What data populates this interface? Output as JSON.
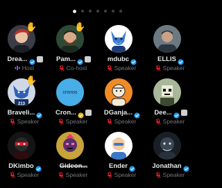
{
  "pager": {
    "count": 7,
    "active": 0
  },
  "participants": [
    {
      "name": "Drea...",
      "role": "Host",
      "role_icon": "host-icon",
      "verified": "blue",
      "raised_hand": true,
      "extra_badge": true,
      "avatar": "person-red-hair"
    },
    {
      "name": "Pam...",
      "role": "Co-host",
      "role_icon": "mic-muted-icon",
      "verified": "blue",
      "raised_hand": true,
      "extra_badge": true,
      "avatar": "person-beard-green"
    },
    {
      "name": "mdubc",
      "role": "Speaker",
      "role_icon": "mic-muted-icon",
      "verified": "blue",
      "raised_hand": false,
      "extra_badge": false,
      "avatar": "blue-fox"
    },
    {
      "name": "ELLIS",
      "role": "Speaker",
      "role_icon": "mic-muted-icon",
      "verified": "blue",
      "raised_hand": false,
      "extra_badge": false,
      "avatar": "man-portrait"
    },
    {
      "name": "Braveli...",
      "role": "Speaker",
      "role_icon": "mic-muted-icon",
      "verified": "blue",
      "raised_hand": true,
      "extra_badge": false,
      "avatar": "blue-wolf-213"
    },
    {
      "name": "Cron...",
      "role": "Speaker",
      "role_icon": "mic-muted-icon",
      "verified": "gold",
      "raised_hand": false,
      "extra_badge": true,
      "avatar": "cronos-logo",
      "avatar_text": "cronos"
    },
    {
      "name": "DGanja...",
      "role": "Speaker",
      "role_icon": "mic-muted-icon",
      "verified": "blue",
      "raised_hand": false,
      "extra_badge": false,
      "avatar": "sketch-character"
    },
    {
      "name": "Dee...",
      "role": "Speaker",
      "role_icon": "mic-muted-icon",
      "verified": "blue",
      "raised_hand": false,
      "extra_badge": true,
      "avatar": "pixel-skull"
    },
    {
      "name": "DKimbo",
      "role": "Speaker",
      "role_icon": "mic-muted-icon",
      "verified": "blue",
      "raised_hand": false,
      "extra_badge": false,
      "avatar": "red-ninja"
    },
    {
      "name": "Gideon...",
      "role": "Speaker",
      "role_icon": "mic-muted-icon",
      "verified": "none",
      "raised_hand": false,
      "extra_badge": false,
      "avatar": "punk-face",
      "strike": true
    },
    {
      "name": "Ender",
      "role": "Speaker",
      "role_icon": "mic-muted-icon",
      "verified": "blue",
      "raised_hand": false,
      "extra_badge": false,
      "avatar": "cartoon-orange-hair"
    },
    {
      "name": "Jonathan",
      "role": "Speaker",
      "role_icon": "mic-muted-icon",
      "verified": "blue",
      "raised_hand": false,
      "extra_badge": false,
      "avatar": "dark-creature"
    }
  ],
  "colors": {
    "verified_blue": "#1d9bf0",
    "verified_gold": "#e2b719",
    "host_purple": "#a66cff",
    "muted_red": "#f4212e",
    "secondary_text": "#71767b"
  }
}
